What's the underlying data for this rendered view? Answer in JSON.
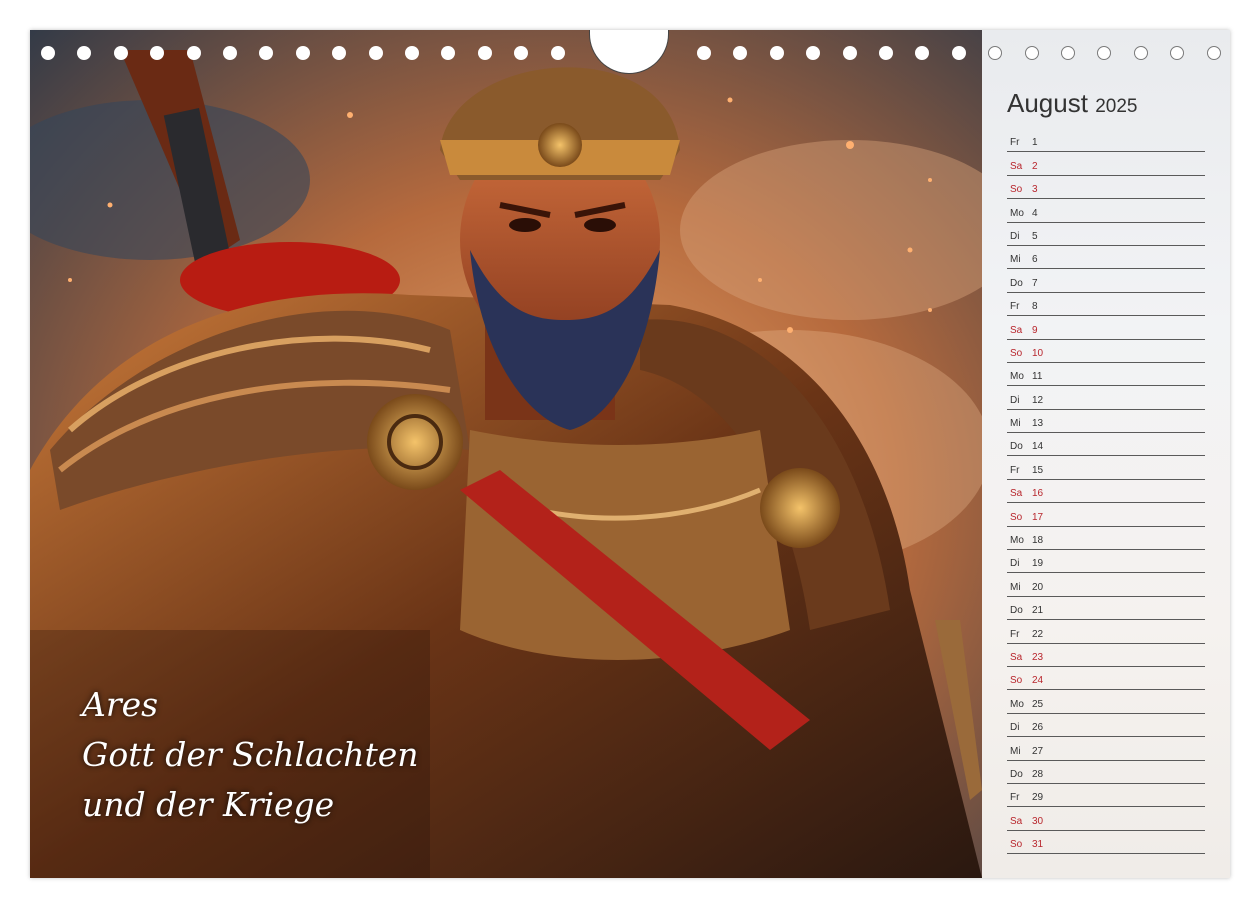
{
  "calendar": {
    "month": "August",
    "year": "2025",
    "days": [
      {
        "dn": "Fr",
        "d": "1",
        "we": false
      },
      {
        "dn": "Sa",
        "d": "2",
        "we": true
      },
      {
        "dn": "So",
        "d": "3",
        "we": true
      },
      {
        "dn": "Mo",
        "d": "4",
        "we": false
      },
      {
        "dn": "Di",
        "d": "5",
        "we": false
      },
      {
        "dn": "Mi",
        "d": "6",
        "we": false
      },
      {
        "dn": "Do",
        "d": "7",
        "we": false
      },
      {
        "dn": "Fr",
        "d": "8",
        "we": false
      },
      {
        "dn": "Sa",
        "d": "9",
        "we": true
      },
      {
        "dn": "So",
        "d": "10",
        "we": true
      },
      {
        "dn": "Mo",
        "d": "11",
        "we": false
      },
      {
        "dn": "Di",
        "d": "12",
        "we": false
      },
      {
        "dn": "Mi",
        "d": "13",
        "we": false
      },
      {
        "dn": "Do",
        "d": "14",
        "we": false
      },
      {
        "dn": "Fr",
        "d": "15",
        "we": false
      },
      {
        "dn": "Sa",
        "d": "16",
        "we": true
      },
      {
        "dn": "So",
        "d": "17",
        "we": true
      },
      {
        "dn": "Mo",
        "d": "18",
        "we": false
      },
      {
        "dn": "Di",
        "d": "19",
        "we": false
      },
      {
        "dn": "Mi",
        "d": "20",
        "we": false
      },
      {
        "dn": "Do",
        "d": "21",
        "we": false
      },
      {
        "dn": "Fr",
        "d": "22",
        "we": false
      },
      {
        "dn": "Sa",
        "d": "23",
        "we": true
      },
      {
        "dn": "So",
        "d": "24",
        "we": true
      },
      {
        "dn": "Mo",
        "d": "25",
        "we": false
      },
      {
        "dn": "Di",
        "d": "26",
        "we": false
      },
      {
        "dn": "Mi",
        "d": "27",
        "we": false
      },
      {
        "dn": "Do",
        "d": "28",
        "we": false
      },
      {
        "dn": "Fr",
        "d": "29",
        "we": false
      },
      {
        "dn": "Sa",
        "d": "30",
        "we": true
      },
      {
        "dn": "So",
        "d": "31",
        "we": true
      }
    ]
  },
  "caption": {
    "line1": "Ares",
    "line2": "Gott der Schlachten",
    "line3": "und der Kriege"
  },
  "colors": {
    "weekend": "#b8262d",
    "weekday": "#333333",
    "sky_dark": "#2e3c4c",
    "sky_warm": "#c9804a",
    "armor": "#8a4a1e"
  }
}
